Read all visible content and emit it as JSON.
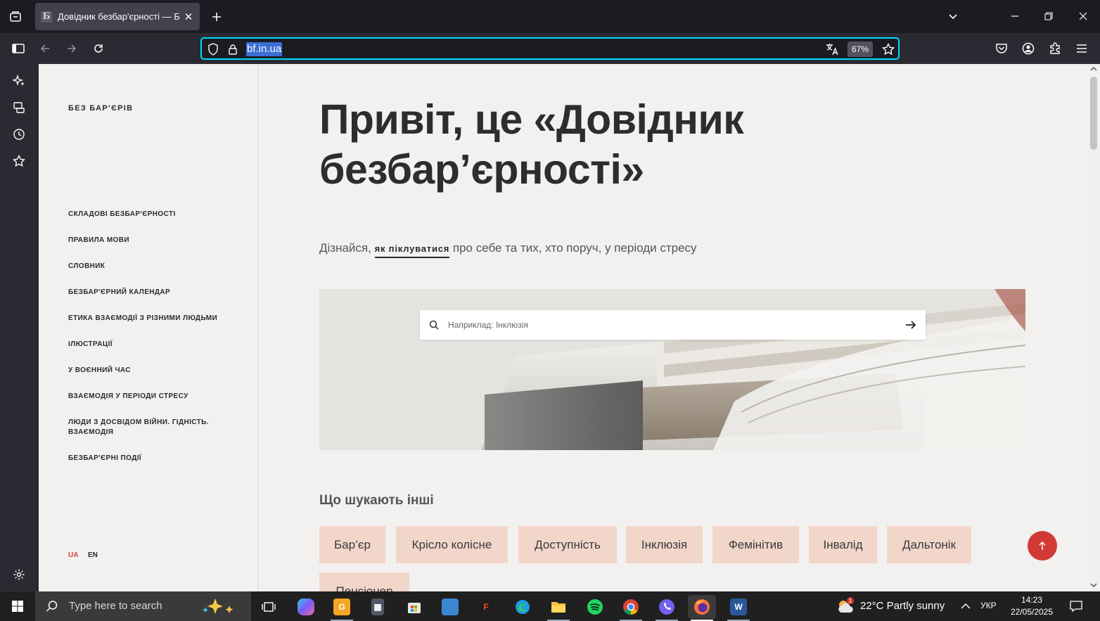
{
  "browser": {
    "tab_title": "Довідник безбар'єрності — Б",
    "tab_favicon_letter": "Б",
    "url": "bf.in.ua",
    "zoom": "67%",
    "accent_color": "#00ddff"
  },
  "site": {
    "brand": "БЕЗ БАР'ЄРІВ",
    "nav": [
      {
        "label": "СКЛАДОВІ БЕЗБАР'ЄРНОСТІ"
      },
      {
        "label": "ПРАВИЛА МОВИ"
      },
      {
        "label": "СЛОВНИК"
      },
      {
        "label": "БЕЗБАР'ЄРНИЙ КАЛЕНДАР"
      },
      {
        "label": "ЕТИКА ВЗАЄМОДІЇ З РІЗНИМИ ЛЮДЬМИ"
      },
      {
        "label": "ІЛЮСТРАЦІЇ"
      },
      {
        "label": "У ВОЄННИЙ ЧАС"
      },
      {
        "label": "ВЗАЄМОДІЯ У ПЕРІОДИ СТРЕСУ"
      },
      {
        "label": "ЛЮДИ З ДОСВІДОМ ВІЙНИ. ГІДНІСТЬ. ВЗАЄМОДІЯ"
      },
      {
        "label": "БЕЗБАР'ЄРНІ ПОДІЇ"
      }
    ],
    "lang_ua": "UA",
    "lang_en": "EN",
    "hero_title": "Привіт, це «Довідник безбар’єрності»",
    "intro_before": "Дізнайся, ",
    "intro_link": "як піклуватися",
    "intro_after": " про себе та тих, хто поруч, у періоди стресу",
    "search_placeholder": "Наприклад: Інклюзія",
    "others_title": "Що шукають інші",
    "chips": [
      "Бар’єр",
      "Крісло колісне",
      "Доступність",
      "Інклюзія",
      "Фемінітив",
      "Інвалід",
      "Дальтонік",
      "Пенсіонер"
    ],
    "brand_red": "#d23a35",
    "chip_color": "#f2d6ca"
  },
  "taskbar": {
    "search_placeholder": "Type here to search",
    "weather": "22°C  Partly sunny",
    "weather_badge": "1",
    "language": "УКР",
    "time": "14:23",
    "date": "22/05/2025",
    "apps": [
      "task-view-icon",
      "copilot-icon",
      "app-icon",
      "calculator-icon",
      "microsoft-store-icon",
      "remote-desktop-icon",
      "figma-icon",
      "edge-icon",
      "file-explorer-icon",
      "spotify-icon",
      "chrome-icon",
      "viber-icon",
      "firefox-icon",
      "word-icon"
    ]
  }
}
